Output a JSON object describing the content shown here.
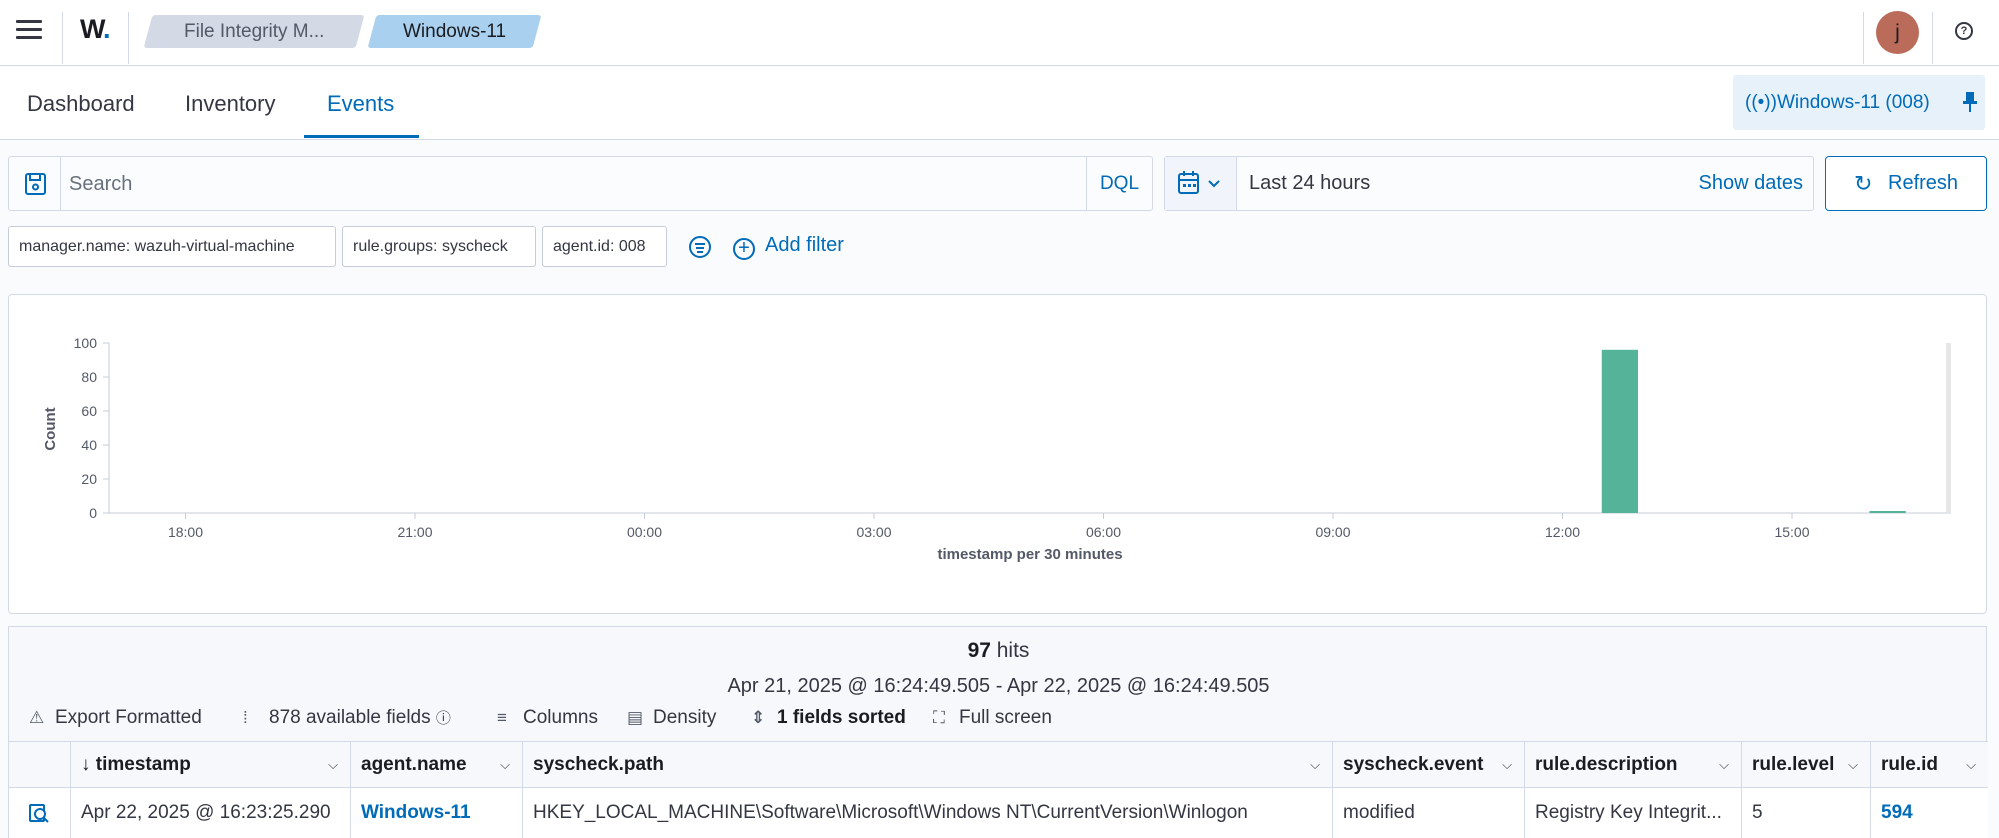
{
  "header": {
    "logo_text": "W",
    "logo_dot": ".",
    "breadcrumbs": [
      "File Integrity M...",
      "Windows-11"
    ],
    "avatar_initial": "j",
    "help_glyph": "?"
  },
  "tabs": [
    {
      "label": "Dashboard",
      "active": false
    },
    {
      "label": "Inventory",
      "active": false
    },
    {
      "label": "Events",
      "active": true
    }
  ],
  "agent_pill": {
    "label": "Windows-11 (008)"
  },
  "search": {
    "placeholder": "Search",
    "value": "",
    "language": "DQL"
  },
  "date": {
    "label": "Last 24 hours",
    "show_dates": "Show dates",
    "refresh": "Refresh"
  },
  "filters": [
    "manager.name: wazuh-virtual-machine",
    "rule.groups: syscheck",
    "agent.id: 008"
  ],
  "add_filter": "Add filter",
  "chart_data": {
    "type": "bar",
    "x": [
      "17:00",
      "17:30",
      "18:00",
      "18:30",
      "19:00",
      "19:30",
      "20:00",
      "20:30",
      "21:00",
      "21:30",
      "22:00",
      "22:30",
      "23:00",
      "23:30",
      "00:00",
      "00:30",
      "01:00",
      "01:30",
      "02:00",
      "02:30",
      "03:00",
      "03:30",
      "04:00",
      "04:30",
      "05:00",
      "05:30",
      "06:00",
      "06:30",
      "07:00",
      "07:30",
      "08:00",
      "08:30",
      "09:00",
      "09:30",
      "10:00",
      "10:30",
      "11:00",
      "11:30",
      "12:00",
      "12:30",
      "13:00",
      "13:30",
      "14:00",
      "14:30",
      "15:00",
      "15:30",
      "16:00"
    ],
    "values": [
      0,
      0,
      0,
      0,
      0,
      0,
      0,
      0,
      0,
      0,
      0,
      0,
      0,
      0,
      0,
      0,
      0,
      0,
      0,
      0,
      0,
      0,
      0,
      0,
      0,
      0,
      0,
      0,
      0,
      0,
      0,
      0,
      0,
      0,
      0,
      0,
      0,
      0,
      0,
      96,
      0,
      0,
      0,
      0,
      0,
      0,
      1
    ],
    "xticks": [
      "18:00",
      "21:00",
      "00:00",
      "03:00",
      "06:00",
      "09:00",
      "12:00",
      "15:00"
    ],
    "yticks": [
      0,
      20,
      40,
      60,
      80,
      100
    ],
    "ylim": [
      0,
      100
    ],
    "xlabel": "timestamp per 30 minutes",
    "ylabel": "Count",
    "bar_color": "#54b399"
  },
  "results": {
    "hits_count": "97",
    "hits_label": " hits",
    "range": "Apr 21, 2025 @ 16:24:49.505 - Apr 22, 2025 @ 16:24:49.505",
    "toolbar": {
      "export": "Export Formatted",
      "fields": "878 available fields",
      "columns": "Columns",
      "density": "Density",
      "sorted": "1 fields sorted",
      "fullscreen": "Full screen"
    },
    "columns": [
      "timestamp",
      "agent.name",
      "syscheck.path",
      "syscheck.event",
      "rule.description",
      "rule.level",
      "rule.id"
    ],
    "rows": [
      {
        "timestamp": "Apr 22, 2025 @ 16:23:25.290",
        "agent_name": "Windows-11",
        "path": "HKEY_LOCAL_MACHINE\\Software\\Microsoft\\Windows NT\\CurrentVersion\\Winlogon",
        "event": "modified",
        "description": "Registry Key Integrit...",
        "level": "5",
        "id": "594"
      }
    ]
  }
}
